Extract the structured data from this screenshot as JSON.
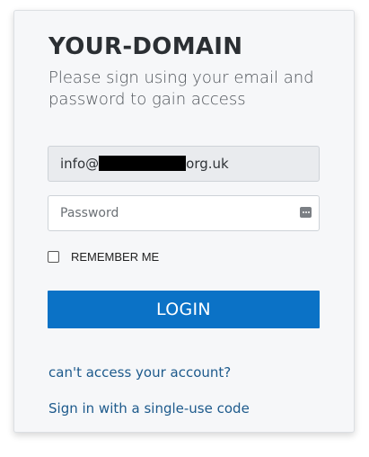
{
  "header": {
    "title": "YOUR-DOMAIN",
    "subtitle": "Please sign using your email and password to gain access"
  },
  "email": {
    "prefix": "info@",
    "suffix": "org.uk",
    "redacted": true
  },
  "password": {
    "placeholder": "Password",
    "icon": "password-manager-icon"
  },
  "remember": {
    "label": "REMEMBER ME",
    "checked": false
  },
  "login": {
    "label": "LOGIN",
    "color": "#0b72c6"
  },
  "links": {
    "cant_access": "can't access your account?",
    "single_use_code": "Sign in with a single-use code"
  }
}
